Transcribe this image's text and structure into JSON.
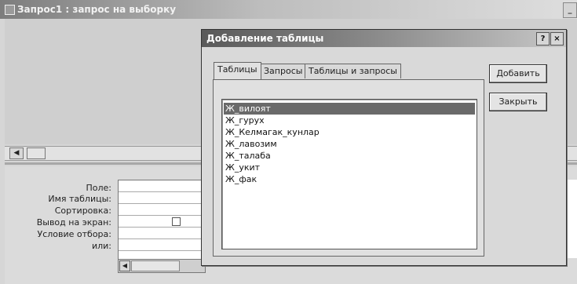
{
  "query_window": {
    "title": "Запрос1 : запрос на выборку",
    "title_right": "_"
  },
  "grid": {
    "row_labels": [
      "Поле:",
      "Имя таблицы:",
      "Сортировка:",
      "Вывод на экран:",
      "Условие отбора:",
      "или:"
    ]
  },
  "dialog": {
    "title": "Добавление таблицы",
    "help_label": "?",
    "close_label": "×",
    "tabs": [
      "Таблицы",
      "Запросы",
      "Таблицы и запросы"
    ],
    "active_tab": "Таблицы",
    "items": [
      "Ж_вилоят",
      "Ж_гурух",
      "Ж_Келмагак_кунлар",
      "Ж_лавозим",
      "Ж_талаба",
      "Ж_укит",
      "Ж_фак"
    ],
    "selected_item": "Ж_вилоят",
    "add_label": "Добавить",
    "close_button_label": "Закрыть"
  }
}
